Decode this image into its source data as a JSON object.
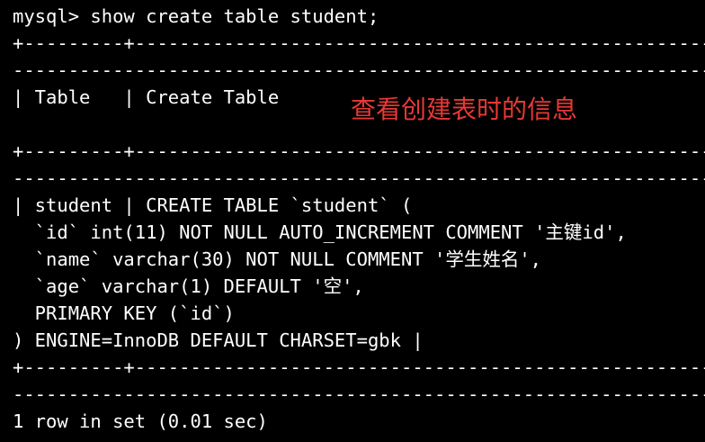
{
  "terminal": {
    "lines": [
      "mysql> show create table student;",
      "+---------+------------------------------------------------------------------",
      "------------------------------------------------------------------------------",
      "| Table   | Create Table",
      "",
      "+---------+------------------------------------------------------------------",
      "------------------------------------------------------------------------------",
      "| student | CREATE TABLE `student` (",
      "  `id` int(11) NOT NULL AUTO_INCREMENT COMMENT '主键id',",
      "  `name` varchar(30) NOT NULL COMMENT '学生姓名',",
      "  `age` varchar(1) DEFAULT '空',",
      "  PRIMARY KEY (`id`)",
      ") ENGINE=InnoDB DEFAULT CHARSET=gbk |",
      "+---------+------------------------------------------------------------------",
      "------------------------------------------------------------------------------",
      "1 row in set (0.01 sec)"
    ],
    "text_color": "#ffffff",
    "background_color": "#000000"
  },
  "annotation": {
    "text": "查看创建表时的信息",
    "color": "#e53935"
  }
}
